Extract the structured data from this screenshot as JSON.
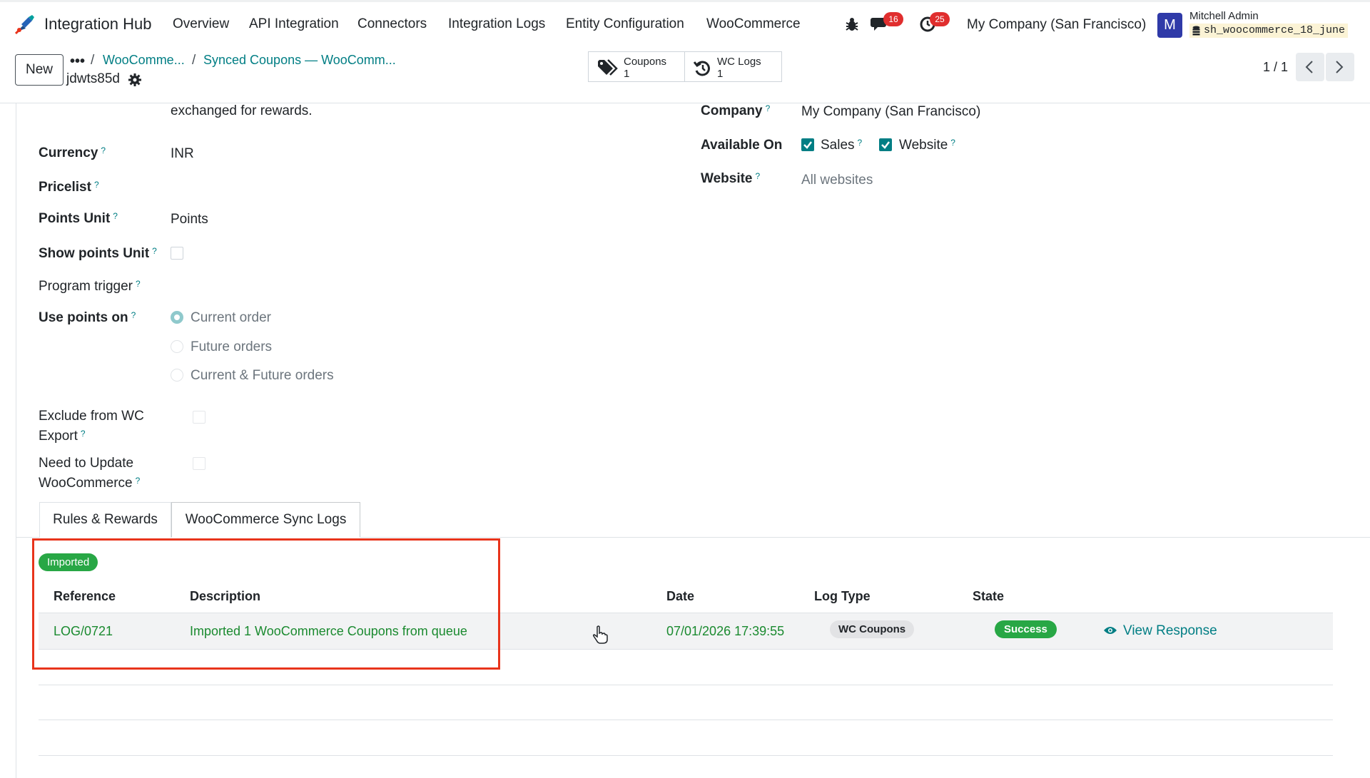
{
  "navbar": {
    "app_name": "Integration Hub",
    "menu": [
      "Overview",
      "API Integration",
      "Connectors",
      "Integration Logs",
      "Entity Configuration",
      "WooCommerce"
    ],
    "messages_count": "16",
    "activities_count": "25",
    "company": "My Company (San Francisco)",
    "avatar_letter": "M",
    "user_name": "Mitchell Admin",
    "database": "sh_woocommerce_18_june"
  },
  "control": {
    "new_label": "New",
    "breadcrumb_dots": "•••",
    "breadcrumb": [
      "WooComme...",
      "Synced Coupons — WooComm..."
    ],
    "record_name": "jdwts85d",
    "smart_buttons": [
      {
        "label": "Coupons",
        "count": "1"
      },
      {
        "label": "WC Logs",
        "count": "1"
      }
    ],
    "pager": "1 / 1"
  },
  "form": {
    "description_tail": "exchanged for rewards.",
    "currency_label": "Currency",
    "currency_value": "INR",
    "pricelist_label": "Pricelist",
    "points_unit_label": "Points Unit",
    "points_unit_value": "Points",
    "show_points_unit_label": "Show points Unit",
    "program_trigger_label": "Program trigger",
    "use_points_on_label": "Use points on",
    "use_points_options": [
      "Current order",
      "Future orders",
      "Current & Future orders"
    ],
    "use_points_selected": "Current order",
    "exclude_label_1": "Exclude from WC",
    "exclude_label_2": "Export",
    "need_update_label_1": "Need to Update",
    "need_update_label_2": "WooCommerce",
    "company_label": "Company",
    "company_value": "My Company (San Francisco)",
    "available_on_label": "Available On",
    "available_sales": "Sales",
    "available_website": "Website",
    "website_label": "Website",
    "website_value": "All websites",
    "help_mark": "?"
  },
  "notebook": {
    "tabs": [
      "Rules & Rewards",
      "WooCommerce Sync Logs"
    ],
    "active_tab": "WooCommerce Sync Logs"
  },
  "logs": {
    "group_badge": "Imported",
    "columns": [
      "Reference",
      "Description",
      "Date",
      "Log Type",
      "State"
    ],
    "rows": [
      {
        "reference": "LOG/0721",
        "description": "Imported 1 WooCommerce Coupons from queue",
        "date": "07/01/2026 17:39:55",
        "log_type": "WC Coupons",
        "state": "Success",
        "action": "View Response"
      }
    ]
  },
  "colors": {
    "brand_teal": "#017e84",
    "success_green": "#28a745",
    "badge_red": "#e02e2e",
    "highlight_red": "#e8341c"
  }
}
